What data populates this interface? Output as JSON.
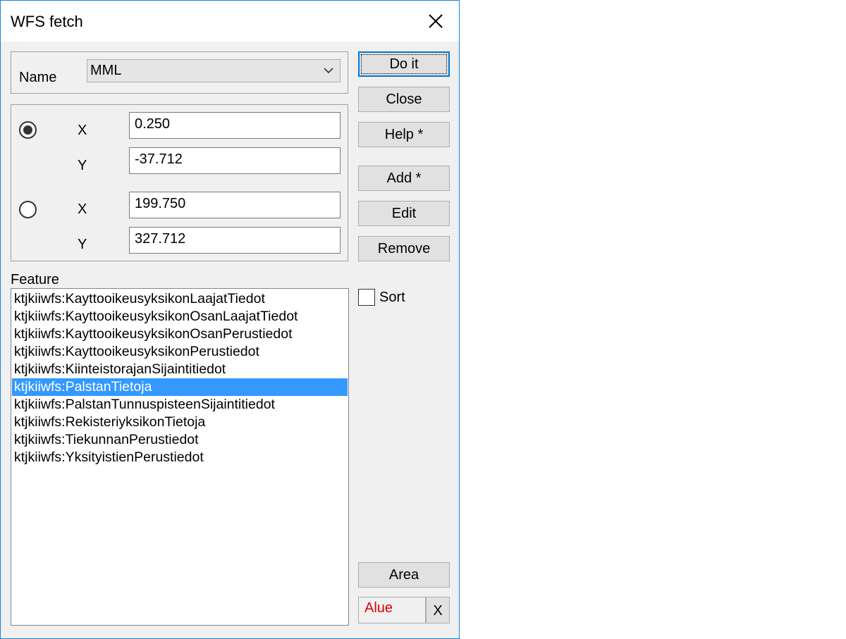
{
  "window": {
    "title": "WFS fetch"
  },
  "name_group": {
    "label": "Name",
    "selected": "MML"
  },
  "coords": {
    "point1": {
      "x_label": "X",
      "y_label": "Y",
      "x_value": "0.250",
      "y_value": "-37.712",
      "selected": true
    },
    "point2": {
      "x_label": "X",
      "y_label": "Y",
      "x_value": "199.750",
      "y_value": "327.712",
      "selected": false
    }
  },
  "buttons": {
    "do_it": "Do it",
    "close": "Close",
    "help": "Help *",
    "add": "Add *",
    "edit": "Edit",
    "remove": "Remove",
    "area": "Area",
    "x": "X"
  },
  "feature": {
    "label": "Feature",
    "items": [
      "ktjkiiwfs:KayttooikeusyksikonLaajatTiedot",
      "ktjkiiwfs:KayttooikeusyksikonOsanLaajatTiedot",
      "ktjkiiwfs:KayttooikeusyksikonOsanPerustiedot",
      "ktjkiiwfs:KayttooikeusyksikonPerustiedot",
      "ktjkiiwfs:KiinteistorajanSijaintitiedot",
      "ktjkiiwfs:PalstanTietoja",
      "ktjkiiwfs:PalstanTunnuspisteenSijaintitiedot",
      "ktjkiiwfs:RekisteriyksikonTietoja",
      "ktjkiiwfs:TiekunnanPerustiedot",
      "ktjkiiwfs:YksityistienPerustiedot"
    ],
    "selected_item": "ktjkiiwfs:PalstanTietoja"
  },
  "sort": {
    "label": "Sort",
    "checked": false
  },
  "area_field": {
    "value": "Alue",
    "color": "#e00000"
  },
  "colors": {
    "accent": "#0078d7",
    "selection": "#3399ff",
    "border": "#1883d7"
  },
  "icons": {
    "close": "close-icon",
    "dropdown": "chevron-down-icon"
  }
}
